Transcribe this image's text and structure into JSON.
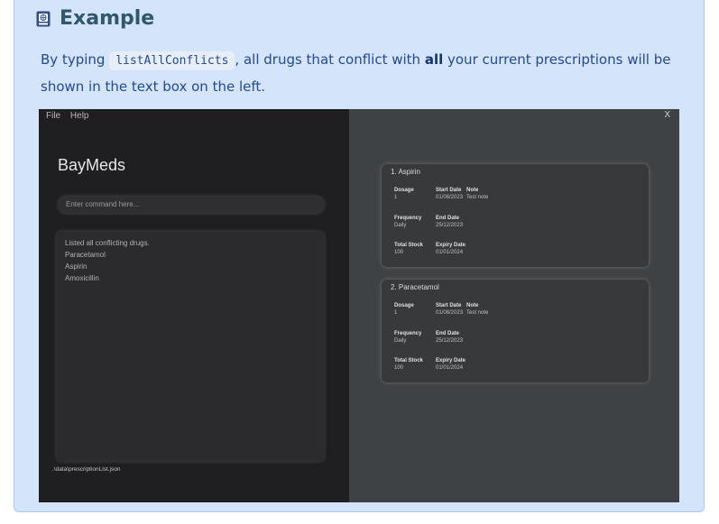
{
  "callout": {
    "title": "Example",
    "text_before": "By typing ",
    "code": "listAllConflicts",
    "text_middle": ", all drugs that conflict with ",
    "text_bold": "all",
    "text_after": " your current prescriptions will be shown in the text box on the left.",
    "icon": "book-icon"
  },
  "app": {
    "menu": [
      "File",
      "Help"
    ],
    "close_label": "X",
    "title": "BayMeds",
    "command_placeholder": "Enter command here...",
    "result_lines": [
      "Listed all conflicting drugs.",
      "Paracetamol",
      "Aspirin",
      "Amoxicillin"
    ],
    "status_path": ".\\data\\prescriptionList.json",
    "cards": [
      {
        "name": "1.  Aspirin",
        "dosage_label": "Dosage",
        "dosage": "1",
        "start_label": "Start Date",
        "start": "01/08/2023",
        "note_label": "Note",
        "note": "Test note",
        "frequency_label": "Frequency",
        "frequency": "Daily",
        "end_label": "End Date",
        "end": "25/12/2023",
        "stock_label": "Total Stock",
        "stock": "100",
        "expiry_label": "Expiry Date",
        "expiry": "01/01/2024"
      },
      {
        "name": "2.  Paracetamol",
        "dosage_label": "Dosage",
        "dosage": "1",
        "start_label": "Start Date",
        "start": "01/08/2023",
        "note_label": "Note",
        "note": "Test note",
        "frequency_label": "Frequency",
        "frequency": "Daily",
        "end_label": "End Date",
        "end": "25/12/2023",
        "stock_label": "Total Stock",
        "stock": "100",
        "expiry_label": "Expiry Date",
        "expiry": "01/01/2024"
      }
    ]
  },
  "colors": {
    "callout_bg": "#d3e4fb",
    "callout_title": "#31576b",
    "callout_text": "#244a8f",
    "app_left_bg": "#1f1f21",
    "app_right_bg": "#3f4244"
  }
}
